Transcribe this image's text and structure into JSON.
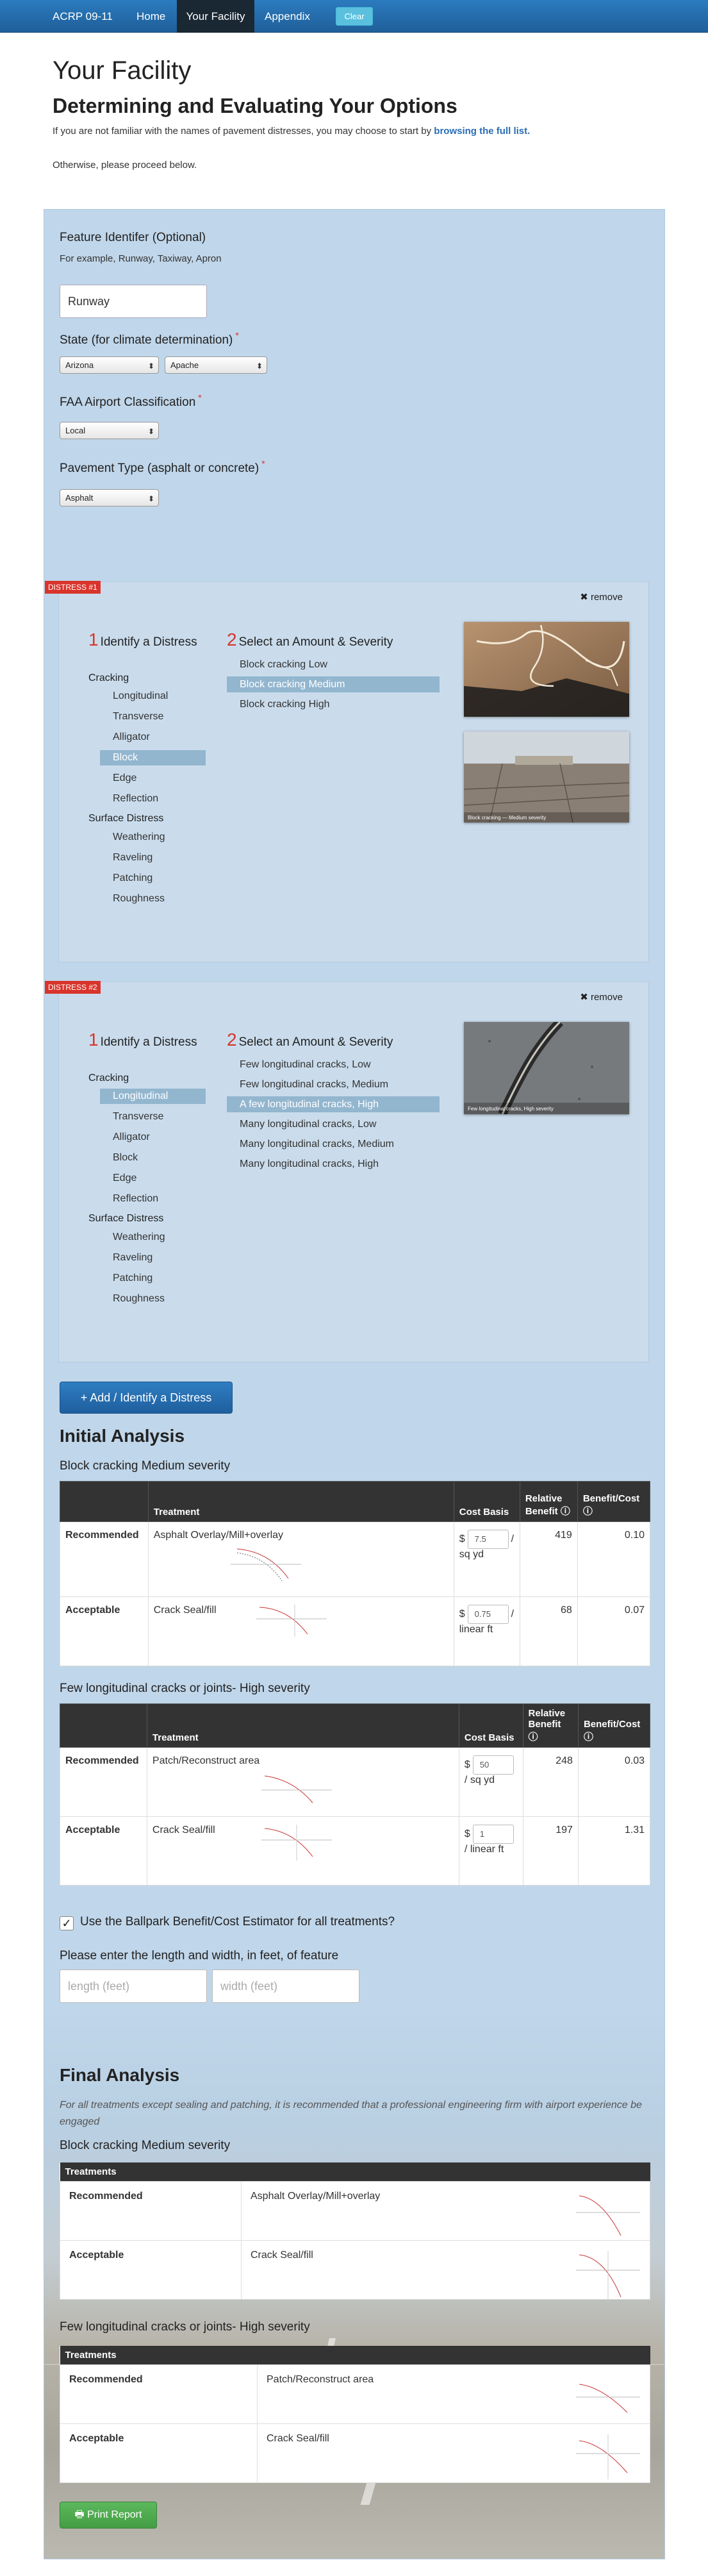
{
  "nav": {
    "brand": "ACRP 09-11",
    "home": "Home",
    "facility": "Your Facility",
    "appendix": "Appendix",
    "clear": "Clear"
  },
  "page": {
    "title": "Your Facility",
    "subtitle": "Determining and Evaluating Your Options",
    "intro_prefix": "If you are not familiar with the names of pavement distresses, you may choose to start by ",
    "intro_link": "browsing the full list.",
    "intro2": "Otherwise, please proceed below."
  },
  "form": {
    "feature_label": "Feature Identifer (Optional)",
    "feature_hint": "For example, Runway, Taxiway, Apron",
    "feature_value": "Runway",
    "state_label": "State (for climate determination)",
    "state_value": "Arizona",
    "county_value": "Apache",
    "faa_label": "FAA Airport Classification",
    "faa_value": "Local",
    "pavement_label": "Pavement Type (asphalt or concrete)",
    "pavement_value": "Asphalt",
    "required_mark": "*"
  },
  "distresses": [
    {
      "badge": "DISTRESS #1",
      "remove": "remove",
      "step1_num": "1",
      "step1_title": "Identify a Distress",
      "step2_num": "2",
      "step2_title": "Select an Amount & Severity",
      "cat_cracking": "Cracking",
      "cracking": [
        "Longitudinal",
        "Transverse",
        "Alligator",
        "Block",
        "Edge",
        "Reflection"
      ],
      "cat_surface": "Surface Distress",
      "surface": [
        "Weathering",
        "Raveling",
        "Patching",
        "Roughness"
      ],
      "severities": [
        "Block cracking Low",
        "Block cracking Medium",
        "Block cracking High"
      ],
      "photo_caption": "Block cracking — Medium severity"
    },
    {
      "badge": "DISTRESS #2",
      "remove": "remove",
      "step1_num": "1",
      "step1_title": "Identify a Distress",
      "step2_num": "2",
      "step2_title": "Select an Amount & Severity",
      "cat_cracking": "Cracking",
      "cracking": [
        "Longitudinal",
        "Transverse",
        "Alligator",
        "Block",
        "Edge",
        "Reflection"
      ],
      "cat_surface": "Surface Distress",
      "surface": [
        "Weathering",
        "Raveling",
        "Patching",
        "Roughness"
      ],
      "severities": [
        "Few longitudinal cracks, Low",
        "Few longitudinal cracks, Medium",
        "A few longitudinal cracks, High",
        "Many longitudinal cracks, Low",
        "Many longitudinal cracks, Medium",
        "Many longitudinal cracks, High"
      ],
      "photo_caption": "Few longitudinal cracks, High severity"
    }
  ],
  "add_button": "+ Add / Identify a Distress",
  "initial": {
    "heading": "Initial Analysis",
    "headers": {
      "treatment": "Treatment",
      "cost": "Cost Basis",
      "benefit": "Relative Benefit ⓘ",
      "bc": "Benefit/Cost ⓘ"
    },
    "sections": [
      {
        "title": "Block cracking Medium severity",
        "rows": [
          {
            "rank": "Recommended",
            "treatment": "Asphalt Overlay/Mill+overlay",
            "currency": "$",
            "cost": "7.5",
            "unit": "/ sq yd",
            "benefit": "419",
            "bc": "0.10"
          },
          {
            "rank": "Acceptable",
            "treatment": "Crack Seal/fill",
            "currency": "$",
            "cost": "0.75",
            "unit": "/ linear ft",
            "benefit": "68",
            "bc": "0.07"
          }
        ]
      },
      {
        "title": "Few longitudinal cracks or joints- High severity",
        "rows": [
          {
            "rank": "Recommended",
            "treatment": "Patch/Reconstruct area",
            "currency": "$",
            "cost": "50",
            "unit": "/ sq yd",
            "benefit": "248",
            "bc": "0.03"
          },
          {
            "rank": "Acceptable",
            "treatment": "Crack Seal/fill",
            "currency": "$",
            "cost": "1",
            "unit": "/ linear ft",
            "benefit": "197",
            "bc": "1.31"
          }
        ]
      }
    ]
  },
  "ballpark": {
    "checkbox_label": "Use the Ballpark Benefit/Cost Estimator for all treatments?",
    "checked_glyph": "✓",
    "size_prompt": "Please enter the length and width, in feet, of feature",
    "length_placeholder": "length (feet)",
    "width_placeholder": "width (feet)"
  },
  "final": {
    "heading": "Final Analysis",
    "note": "For all treatments except sealing and patching, it is recommended that a professional engineering firm with airport experience be engaged",
    "header": "Treatments",
    "sections": [
      {
        "title": "Block cracking Medium severity",
        "rows": [
          {
            "rank": "Recommended",
            "treatment": "Asphalt Overlay/Mill+overlay"
          },
          {
            "rank": "Acceptable",
            "treatment": "Crack Seal/fill"
          }
        ]
      },
      {
        "title": "Few longitudinal cracks or joints- High severity",
        "rows": [
          {
            "rank": "Recommended",
            "treatment": "Patch/Reconstruct area"
          },
          {
            "rank": "Acceptable",
            "treatment": "Crack Seal/fill"
          }
        ]
      }
    ]
  },
  "print_button": "🖶 Print Report",
  "colors": {
    "accent": "#2a6db5",
    "required": "#d9342b",
    "panel": "#c0d6ea",
    "selected": "#93b6cf",
    "success": "#5cb85c"
  }
}
